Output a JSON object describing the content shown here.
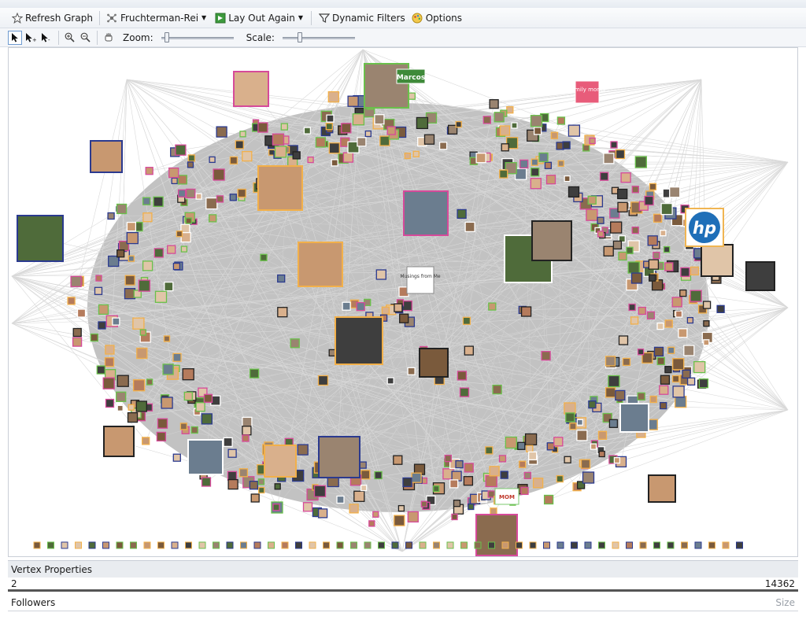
{
  "toolbar": {
    "refresh_label": "Refresh Graph",
    "layout_label": "Fruchterman-Rei",
    "layout_again_label": "Lay Out Again",
    "filters_label": "Dynamic Filters",
    "options_label": "Options"
  },
  "toolbar2": {
    "zoom_label": "Zoom:",
    "scale_label": "Scale:",
    "zoom_value": 0.05,
    "scale_value": 0.22
  },
  "graph": {
    "overlay_texts": {
      "marcos": "Marcos",
      "family_moms": "family moms",
      "hp": "hp",
      "musings": "Musings from Me",
      "mom": "MOM"
    }
  },
  "vertex_properties": {
    "title": "Vertex Properties",
    "row1_left": "2",
    "row1_right": "14362",
    "row2_label": "Followers",
    "row2_hint": "Size"
  },
  "colors": {
    "graph_bg": "#c2c2c2",
    "accent": "#3b78c6"
  }
}
